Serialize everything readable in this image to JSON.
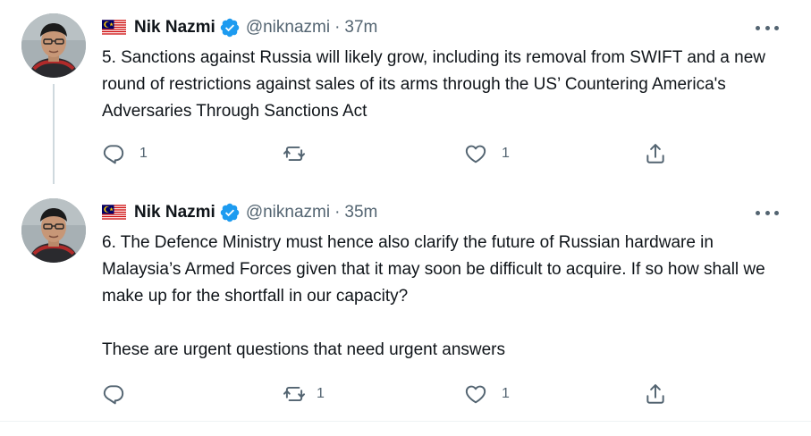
{
  "tweets": [
    {
      "author": {
        "flag": "🇲🇾",
        "name": "Nik Nazmi",
        "handle": "@niknazmi",
        "verified": true
      },
      "separator": "·",
      "time": "37m",
      "text": "5. Sanctions against Russia will likely grow, including its removal from SWIFT and a new round of restrictions against sales of its arms through the US’ Countering America's Adversaries Through Sanctions Act",
      "counts": {
        "replies": "1",
        "retweets": "",
        "likes": "1"
      }
    },
    {
      "author": {
        "flag": "🇲🇾",
        "name": "Nik Nazmi",
        "handle": "@niknazmi",
        "verified": true
      },
      "separator": "·",
      "time": "35m",
      "text": "6. The Defence Ministry must hence also clarify the future of Russian hardware in Malaysia’s Armed Forces given that it may soon be difficult to acquire. If so how shall we make up for the shortfall in our capacity?\n\nThese are urgent questions that need urgent answers",
      "counts": {
        "replies": "",
        "retweets": "1",
        "likes": "1"
      }
    }
  ],
  "colors": {
    "verified": "#1d9bf0",
    "secondary_text": "#536471",
    "thread_line": "#cfd9de"
  },
  "icons": [
    "flag-malaysia-icon",
    "verified-badge-icon",
    "more-options-icon",
    "reply-icon",
    "retweet-icon",
    "like-icon",
    "share-icon"
  ]
}
